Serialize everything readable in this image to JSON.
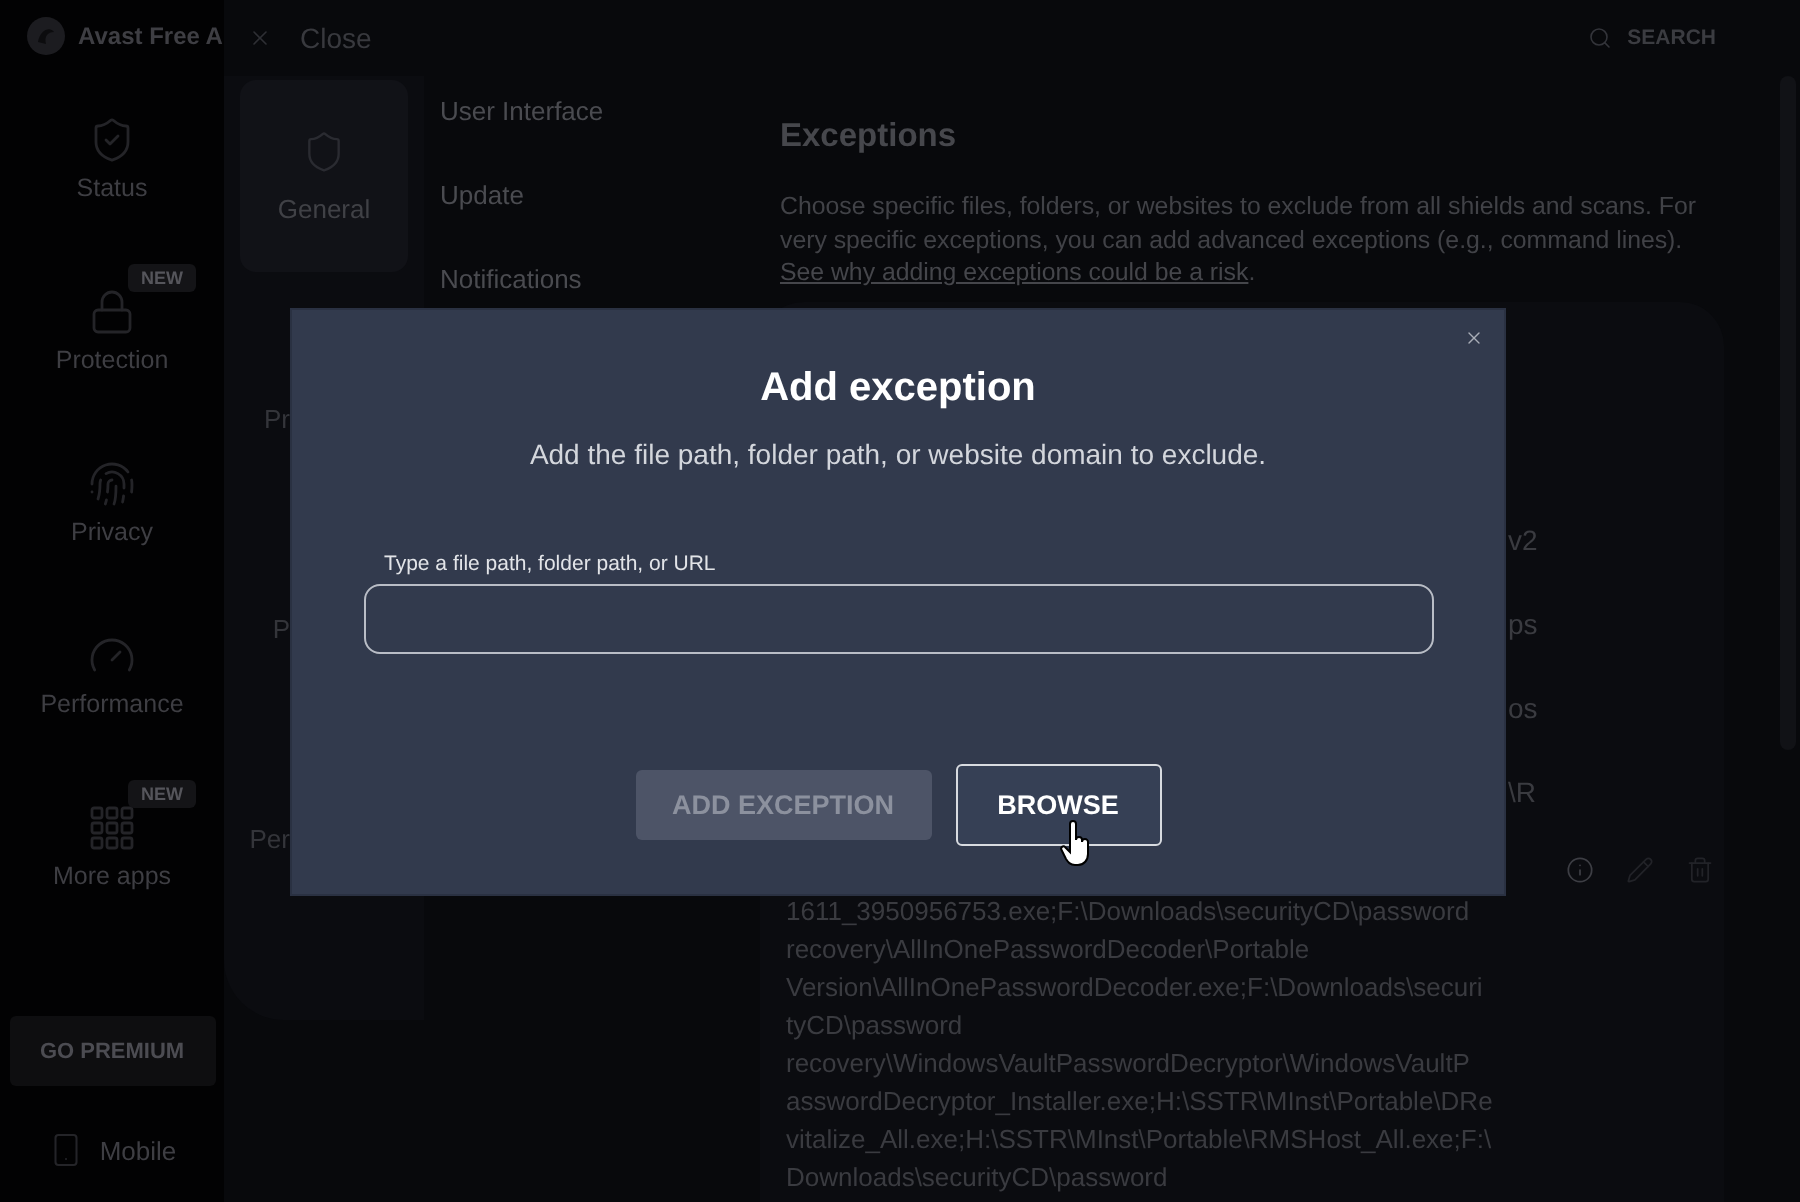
{
  "sidebar": {
    "app_title": "Avast Free A",
    "items": [
      {
        "label": "Status"
      },
      {
        "label": "Protection",
        "badge": "NEW"
      },
      {
        "label": "Privacy"
      },
      {
        "label": "Performance"
      },
      {
        "label": "More apps",
        "badge": "NEW"
      }
    ],
    "premium_button": "GO PREMIUM",
    "mobile_link": "Mobile"
  },
  "top_bar": {
    "close": "Close",
    "search": "SEARCH"
  },
  "settings_nav": {
    "categories": [
      {
        "label": "General",
        "selected": true
      },
      {
        "label": "Pr",
        "selected": false
      },
      {
        "label": "P",
        "selected": false
      },
      {
        "label": "Per",
        "selected": false
      }
    ],
    "subsections": [
      "User Interface",
      "Update",
      "Notifications"
    ]
  },
  "exceptions": {
    "title": "Exceptions",
    "description": "Choose specific files, folders, or websites to exclude from all shields and scans. For very specific exceptions, you can add advanced exceptions (e.g., command lines).",
    "risk_link": "See why adding exceptions could be a risk",
    "risk_link_suffix": ".",
    "rows": [
      {
        "text": "v2"
      },
      {
        "text": "ps"
      },
      {
        "text": "os"
      },
      {
        "text": "\\R"
      }
    ],
    "path_lines": [
      "1611_3950956753.exe;F:\\Downloads\\securityCD\\password",
      "recovery\\AllInOnePasswordDecoder\\Portable",
      "Version\\AllInOnePasswordDecoder.exe;F:\\Downloads\\securi",
      "tyCD\\password",
      "recovery\\WindowsVaultPasswordDecryptor\\WindowsVaultP",
      "asswordDecryptor_Installer.exe;H:\\SSTR\\MInst\\Portable\\DRe",
      "vitalize_All.exe;H:\\SSTR\\MInst\\Portable\\RMSHost_All.exe;F:\\",
      "Downloads\\securityCD\\password"
    ]
  },
  "dialog": {
    "title": "Add exception",
    "subtitle": "Add the file path, folder path, or website domain to exclude.",
    "field_label": "Type a file path, folder path, or URL",
    "buttons": [
      {
        "label": "ADD EXCEPTION",
        "disabled": true
      },
      {
        "label": "BROWSE",
        "disabled": false
      }
    ]
  }
}
